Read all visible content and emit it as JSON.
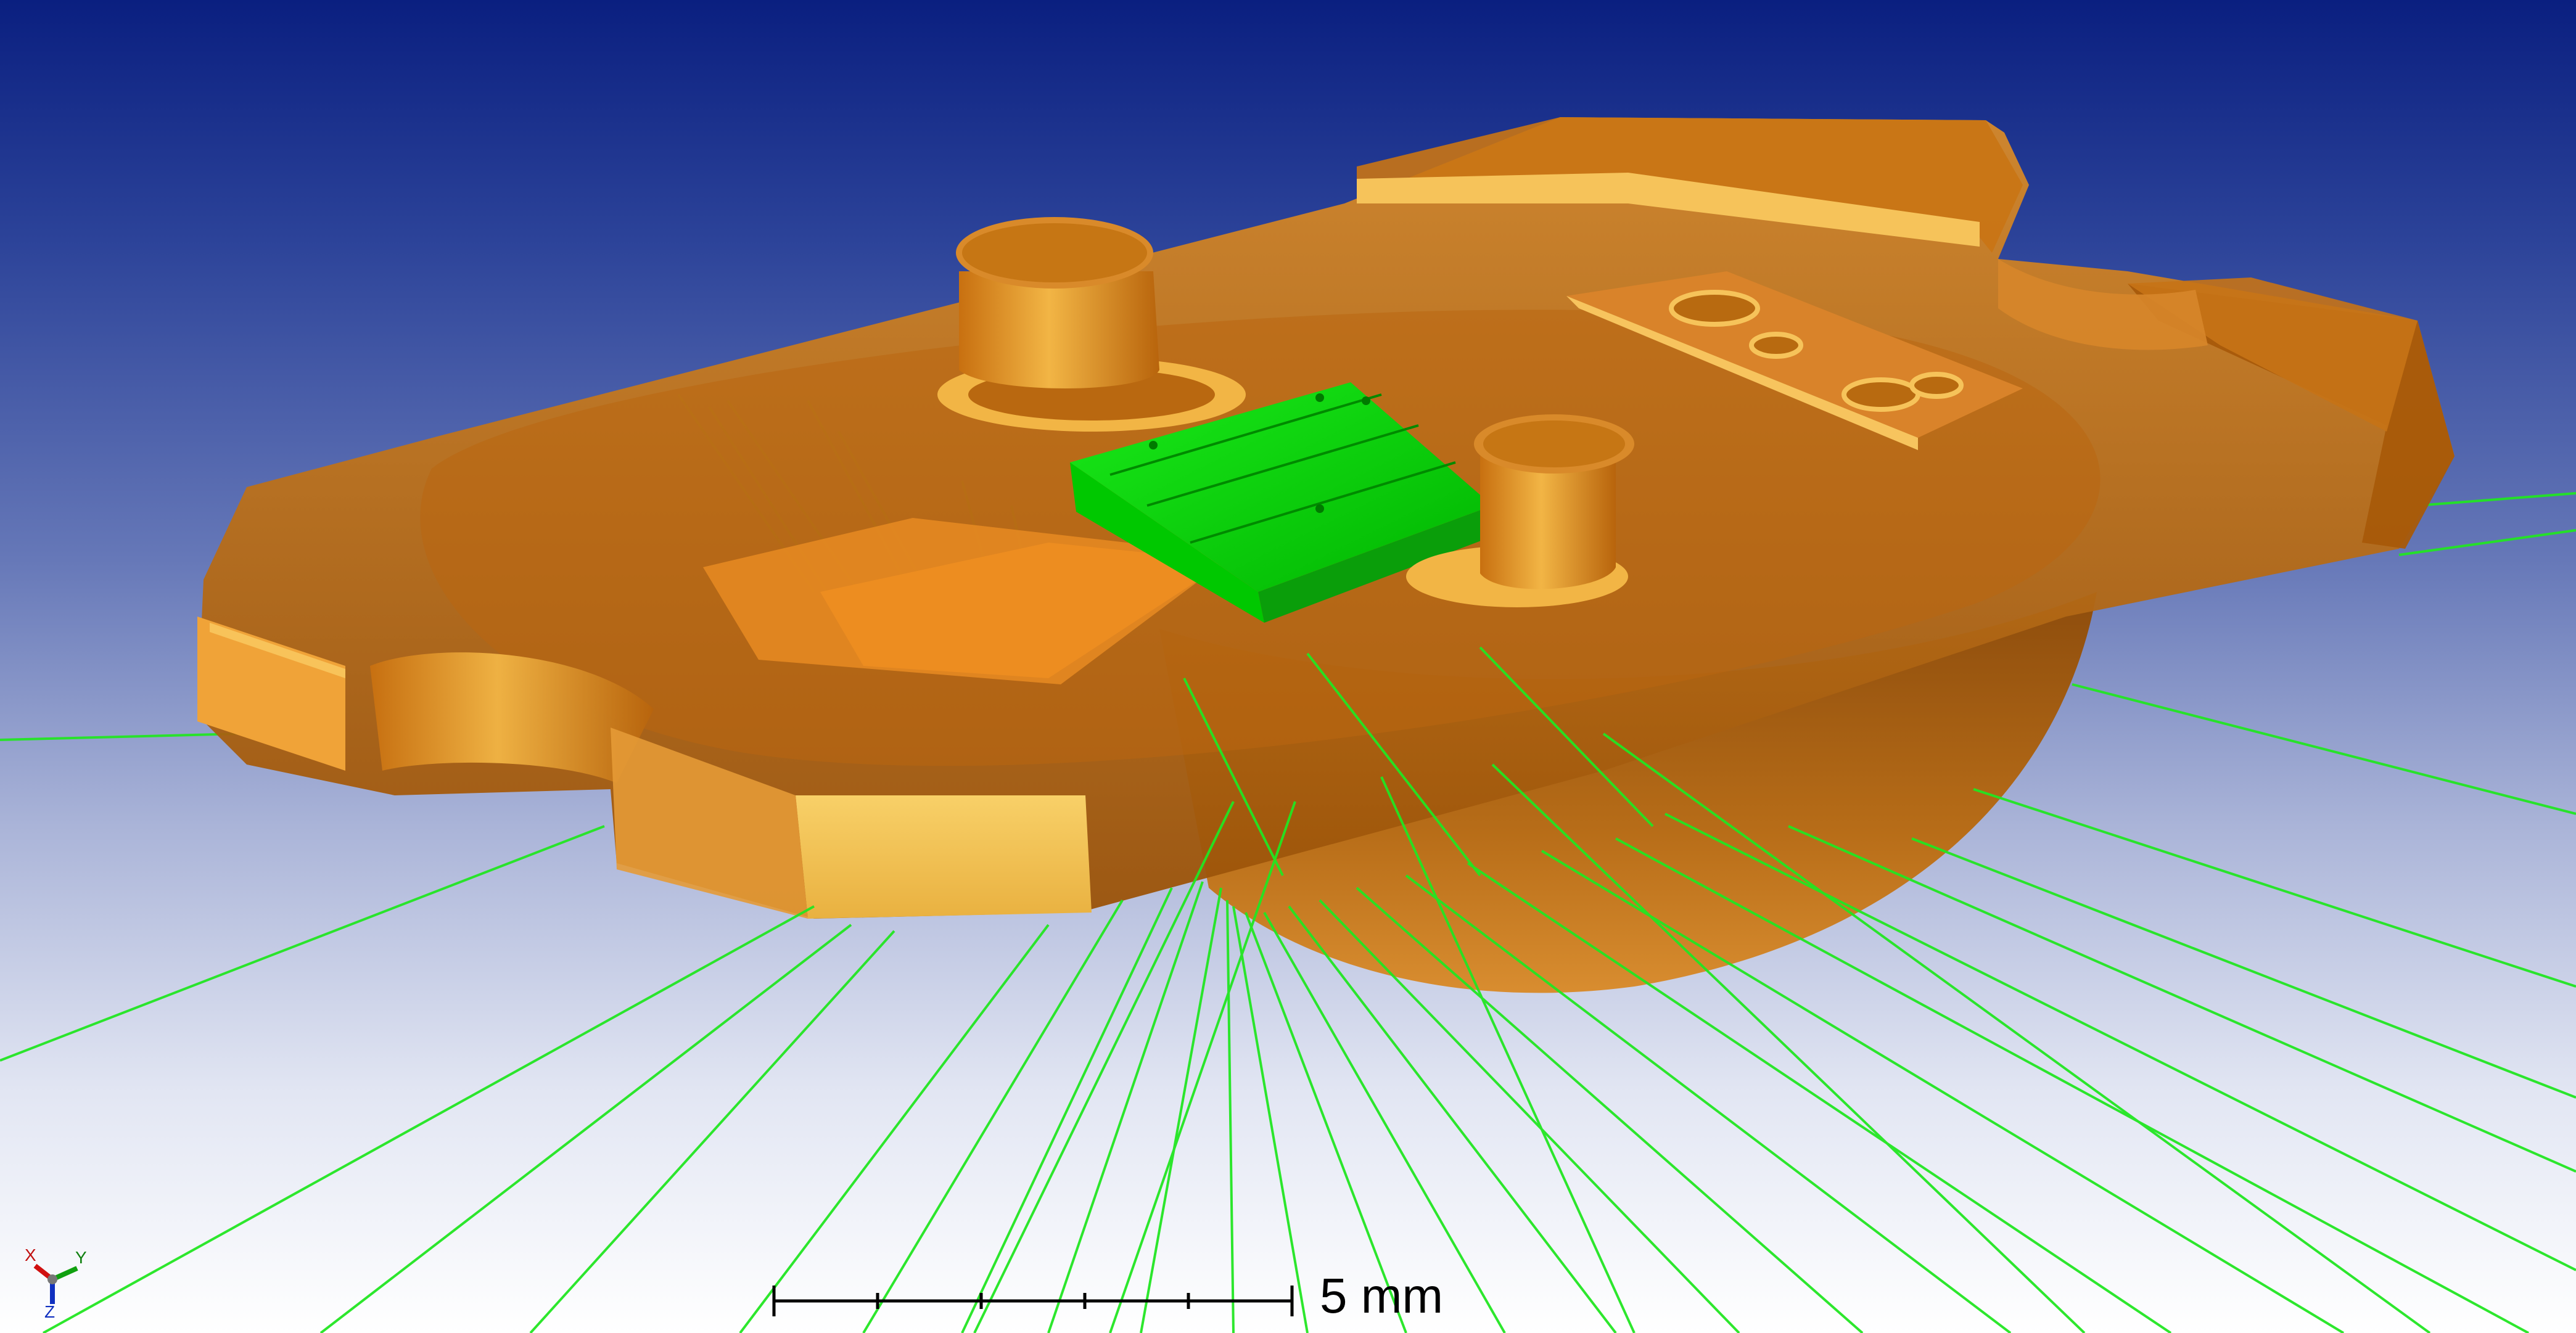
{
  "scale_bar": {
    "label": "5 mm"
  },
  "axis_triad": {
    "x_label": "X",
    "y_label": "Y",
    "z_label": "Z"
  },
  "scene": {
    "housing_color": "#C8700F",
    "chip_color": "#00C800",
    "ray_color": "#22E622"
  }
}
